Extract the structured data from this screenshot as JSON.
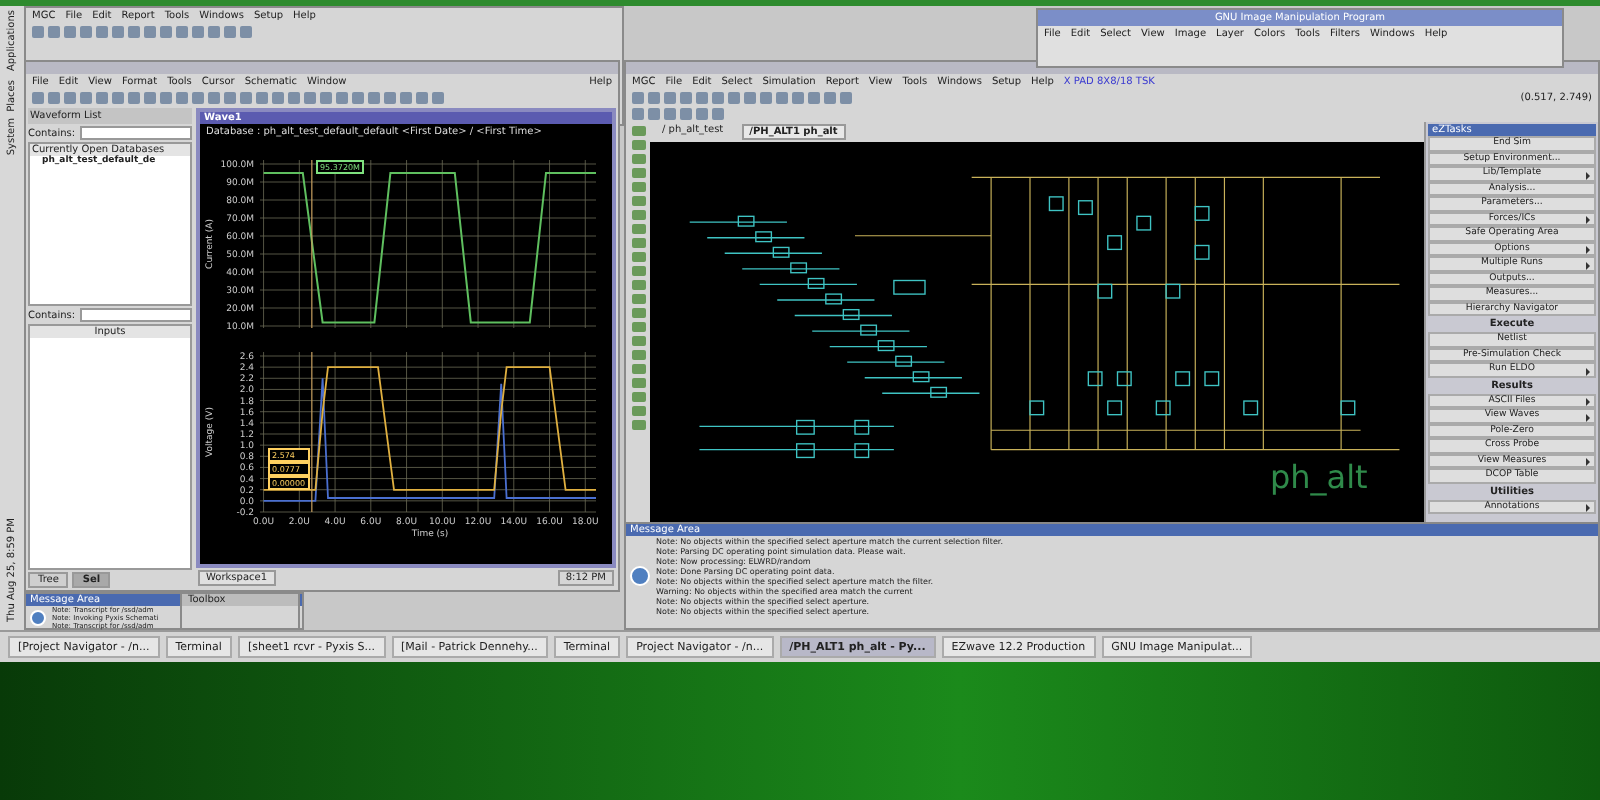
{
  "desktop_panel": {
    "menus": [
      "Applications",
      "Places",
      "System"
    ],
    "clock": "Thu Aug 25,  8:59 PM"
  },
  "mgc_window": {
    "menu": [
      "MGC",
      "File",
      "Edit",
      "Report",
      "Tools",
      "Windows",
      "Setup",
      "Help"
    ]
  },
  "ezwave_window": {
    "menu": [
      "File",
      "Edit",
      "View",
      "Format",
      "Tools",
      "Cursor",
      "Schematic",
      "Window"
    ],
    "help": "Help",
    "waveform_list": {
      "title": "Waveform List",
      "contains_label": "Contains:",
      "header": "Currently Open Databases",
      "databases": [
        "ph_alt_test_default_de"
      ],
      "lower_contains_label": "Contains:",
      "lower_header": "Inputs"
    },
    "bottom_tabs": [
      {
        "label": "Tree",
        "selected": false
      },
      {
        "label": "Sel",
        "selected": true
      }
    ],
    "wave_window": {
      "title": "Wave1",
      "header": "Database : ph_alt_test_default_default    <First Date> / <First Time>",
      "cursor_readout": "95.3720M",
      "top_plot": {
        "chart_data": {
          "type": "line",
          "ylabel": "Current (A)",
          "x": [
            0,
            2.2,
            3.3,
            6.2,
            7.1,
            10.7,
            11.6,
            14.9,
            15.8,
            18.6
          ],
          "series": [
            {
              "color": "#5fbf5f",
              "values": [
                95,
                95,
                12,
                12,
                95,
                95,
                12,
                12,
                95,
                95
              ]
            }
          ],
          "xlim": [
            -0.2,
            18.6
          ],
          "ylim": [
            10,
            100
          ],
          "grid": true,
          "ref_lines": [
            {
              "axis": "x",
              "value": 2.7,
              "color": "#c8a060"
            }
          ],
          "yticks": [
            {
              "value": 100,
              "label": "100.0M"
            },
            {
              "value": 90,
              "label": "90.0M"
            },
            {
              "value": 80,
              "label": "80.0M"
            },
            {
              "value": 70,
              "label": "70.0M"
            },
            {
              "value": 60,
              "label": "60.0M"
            },
            {
              "value": 50,
              "label": "50.0M"
            },
            {
              "value": 40,
              "label": "40.0M"
            },
            {
              "value": 30,
              "label": "30.0M"
            },
            {
              "value": 20,
              "label": "20.0M"
            },
            {
              "value": 10,
              "label": "10.0M"
            }
          ]
        }
      },
      "bottom_plot": {
        "chart_data": {
          "type": "line",
          "xlabel": "Time (s)",
          "ylabel": "Voltage (V)",
          "x": [
            0,
            2.9,
            3.3,
            3.6,
            6.4,
            7.3,
            11.6,
            12.9,
            13.3,
            13.6,
            16,
            16.9,
            18.6
          ],
          "series": [
            {
              "color": "#4a6fd0",
              "values": [
                0.0,
                0.0,
                2.2,
                0.05,
                0.05,
                0.05,
                0.05,
                0.05,
                2.1,
                0.05,
                0.05,
                0.05,
                0.05
              ]
            },
            {
              "color": "#e0b040",
              "values": [
                0.2,
                0.2,
                1.6,
                2.4,
                2.4,
                0.2,
                0.2,
                0.2,
                1.6,
                2.4,
                2.4,
                0.2,
                0.2
              ]
            }
          ],
          "xlim": [
            -0.2,
            18.6
          ],
          "ylim": [
            -0.2,
            2.6
          ],
          "grid": true,
          "ref_lines": [
            {
              "axis": "x",
              "value": 2.7,
              "color": "#c8a060"
            }
          ],
          "xticks": [
            {
              "value": 0,
              "label": "0.0U"
            },
            {
              "value": 2,
              "label": "2.0U"
            },
            {
              "value": 4,
              "label": "4.0U"
            },
            {
              "value": 6,
              "label": "6.0U"
            },
            {
              "value": 8,
              "label": "8.0U"
            },
            {
              "value": 10,
              "label": "10.0U"
            },
            {
              "value": 12,
              "label": "12.0U"
            },
            {
              "value": 14,
              "label": "14.0U"
            },
            {
              "value": 16,
              "label": "16.0U"
            },
            {
              "value": 18,
              "label": "18.0U"
            }
          ],
          "yticks": [
            {
              "value": 2.6,
              "label": "2.6"
            },
            {
              "value": 2.4,
              "label": "2.4"
            },
            {
              "value": 2.2,
              "label": "2.2"
            },
            {
              "value": 2.0,
              "label": "2.0"
            },
            {
              "value": 1.8,
              "label": "1.8"
            },
            {
              "value": 1.6,
              "label": "1.6"
            },
            {
              "value": 1.4,
              "label": "1.4"
            },
            {
              "value": 1.2,
              "label": "1.2"
            },
            {
              "value": 1.0,
              "label": "1.0"
            },
            {
              "value": 0.8,
              "label": "0.8"
            },
            {
              "value": 0.6,
              "label": "0.6"
            },
            {
              "value": 0.4,
              "label": "0.4"
            },
            {
              "value": 0.2,
              "label": "0.2"
            },
            {
              "value": 0.0,
              "label": "0.0"
            },
            {
              "value": -0.2,
              "label": "-0.2"
            }
          ]
        },
        "readouts": [
          "2.574",
          "0.0777",
          "0.00000"
        ]
      }
    },
    "workspace_tab": "Workspace1",
    "status": "8:12 PM"
  },
  "left_message_area": {
    "title": "Message Area",
    "lines": [
      "Note: Transcript for /ssd/adm",
      "Note: Invoking Pyxis Schemati",
      "Note: Transcript for /ssd/adm"
    ]
  },
  "toolbox": {
    "title": "Toolbox"
  },
  "gimp_window": {
    "title": "GNU Image Manipulation Program",
    "menu": [
      "File",
      "Edit",
      "Select",
      "View",
      "Image",
      "Layer",
      "Colors",
      "Tools",
      "Filters",
      "Windows",
      "Help"
    ]
  },
  "schematic_window": {
    "menu": [
      "MGC",
      "File",
      "Edit",
      "Select",
      "Simulation",
      "Report",
      "View",
      "Tools",
      "Windows",
      "Setup",
      "Help"
    ],
    "context": "X PAD 8X8/18 TSK",
    "coords": "(0.517, 2.749)",
    "tabs": [
      {
        "label": "/ ph_alt_test",
        "selected": false
      },
      {
        "label": "/PH_ALT1 ph_alt",
        "selected": true
      }
    ],
    "schematic_label": "ph_alt",
    "task_panel": {
      "title": "eZTasks",
      "items": [
        {
          "kind": "item",
          "label": "End Sim",
          "submenu": false
        },
        {
          "kind": "item",
          "label": "Setup Environment...",
          "submenu": false
        },
        {
          "kind": "item",
          "label": "Lib/Template",
          "submenu": true
        },
        {
          "kind": "item",
          "label": "Analysis...",
          "submenu": false
        },
        {
          "kind": "item",
          "label": "Parameters...",
          "submenu": false
        },
        {
          "kind": "item",
          "label": "Forces/ICs",
          "submenu": true
        },
        {
          "kind": "item",
          "label": "Safe Operating Area",
          "submenu": false
        },
        {
          "kind": "item",
          "label": "Options",
          "submenu": true
        },
        {
          "kind": "item",
          "label": "Multiple Runs",
          "submenu": true
        },
        {
          "kind": "item",
          "label": "Outputs...",
          "submenu": false
        },
        {
          "kind": "item",
          "label": "Measures...",
          "submenu": false
        },
        {
          "kind": "item",
          "label": "Hierarchy Navigator",
          "submenu": false
        },
        {
          "kind": "header",
          "label": "Execute"
        },
        {
          "kind": "item",
          "label": "Netlist",
          "submenu": false
        },
        {
          "kind": "item",
          "label": "Pre-Simulation Check",
          "submenu": false
        },
        {
          "kind": "item",
          "label": "Run ELDO",
          "submenu": true
        },
        {
          "kind": "header",
          "label": "Results"
        },
        {
          "kind": "item",
          "label": "ASCII Files",
          "submenu": true
        },
        {
          "kind": "item",
          "label": "View Waves",
          "submenu": true
        },
        {
          "kind": "item",
          "label": "Pole-Zero",
          "submenu": false
        },
        {
          "kind": "item",
          "label": "Cross Probe",
          "submenu": false
        },
        {
          "kind": "item",
          "label": "View Measures",
          "submenu": true
        },
        {
          "kind": "item",
          "label": "DCOP Table",
          "submenu": false
        },
        {
          "kind": "header",
          "label": "Utilities"
        },
        {
          "kind": "item",
          "label": "Annotations",
          "submenu": true
        }
      ]
    },
    "message_area": {
      "title": "Message Area",
      "lines": [
        "Note: No objects within the specified select aperture match the current selection filter.",
        "Note: Parsing DC operating point simulation data.  Please wait.",
        "Note: Now processing: ELWRD/random",
        "Note: Done Parsing DC operating point data.",
        "Note: No objects within the specified select aperture match the filter.",
        "Warning: No objects within the specified area match the current",
        "Note: No objects within the specified select aperture.",
        "Note: No objects within the specified select aperture."
      ]
    }
  },
  "taskbar": [
    {
      "label": "[Project Navigator - /n...",
      "selected": false
    },
    {
      "label": "Terminal",
      "selected": false
    },
    {
      "label": "[sheet1 rcvr - Pyxis S...",
      "selected": false
    },
    {
      "label": "[Mail - Patrick Dennehy...",
      "selected": false
    },
    {
      "label": "Terminal",
      "selected": false
    },
    {
      "label": "Project Navigator - /n...",
      "selected": false
    },
    {
      "label": "/PH_ALT1 ph_alt - Py...",
      "selected": true
    },
    {
      "label": "EZwave 12.2 Production",
      "selected": false
    },
    {
      "label": "GNU Image Manipulat...",
      "selected": false
    }
  ]
}
